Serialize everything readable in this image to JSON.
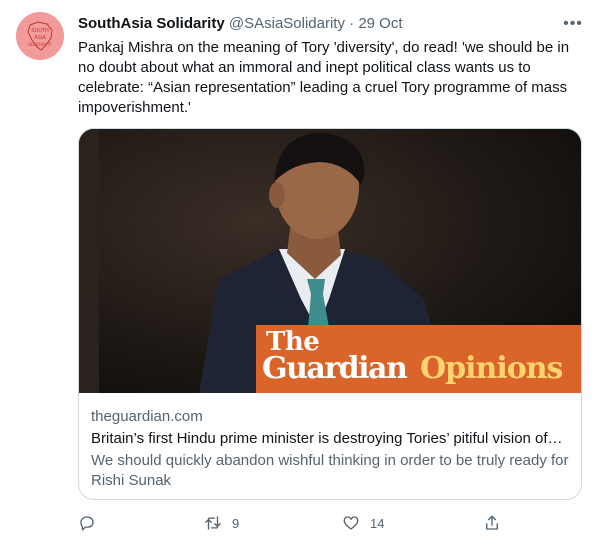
{
  "tweet": {
    "author_name": "SouthAsia Solidarity",
    "handle": "@SAsiaSolidarity",
    "separator": "·",
    "time": "29 Oct",
    "text": "Pankaj Mishra on the meaning of Tory 'diversity', do read! 'we should be in no doubt about what an immoral and inept political class wants us to celebrate: “Asian representation” leading a cruel Tory programme of mass impoverishment.'",
    "more_icon": "ellipsis-icon"
  },
  "avatar": {
    "lines": [
      "SOUTH",
      "ASIA",
      "SOLIDARITY"
    ],
    "color": "#f39a9a"
  },
  "card": {
    "banner": {
      "the": "The",
      "guardian": "Guardian",
      "opinions": "Opinions",
      "bg_color": "#d9652a",
      "opinions_color": "#ffd470"
    },
    "domain": "theguardian.com",
    "title": "Britain’s first Hindu prime minister is destroying Tories’ pitiful vision of…",
    "description": "We should quickly abandon wishful thinking in order to be truly ready for Rishi Sunak"
  },
  "actions": {
    "reply": {
      "icon": "reply-icon",
      "count": ""
    },
    "retweet": {
      "icon": "retweet-icon",
      "count": "9"
    },
    "like": {
      "icon": "heart-icon",
      "count": "14"
    },
    "share": {
      "icon": "share-icon",
      "count": ""
    }
  },
  "colors": {
    "text": "#0f1419",
    "secondary": "#536471",
    "border": "#cfd9de"
  }
}
